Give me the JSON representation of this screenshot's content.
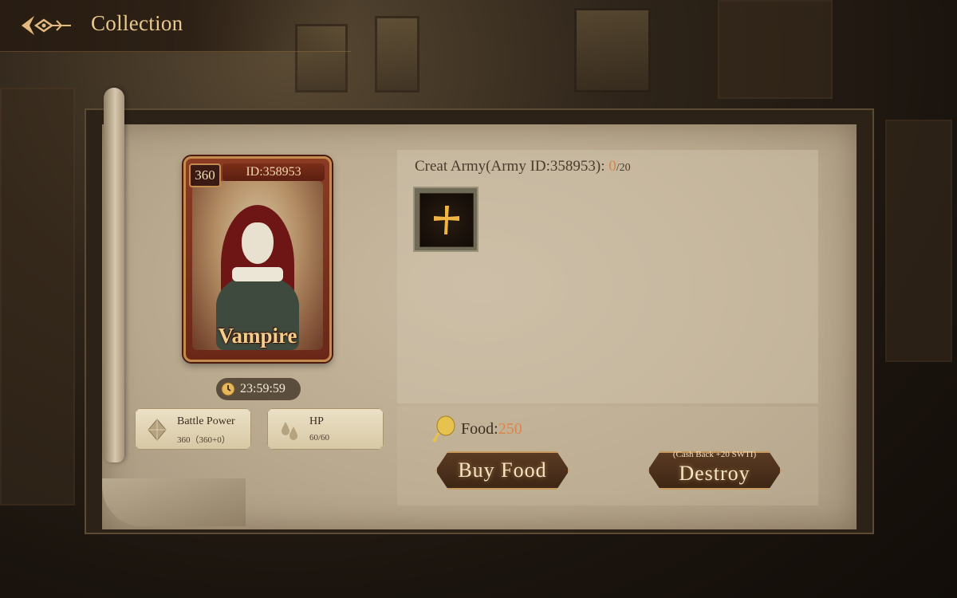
{
  "header": {
    "title": "Collection",
    "back_icon": "back-arrow-icon"
  },
  "hero": {
    "level": "360",
    "id_text": "ID:358953",
    "name": "Vampire",
    "timer": "23:59:59"
  },
  "stats": {
    "battle_power": {
      "label": "Battle Power",
      "value": "360（360+0）",
      "icon": "diamond-crystal-icon"
    },
    "hp": {
      "label": "HP",
      "value": "60/60",
      "icon": "blood-drops-icon"
    }
  },
  "army": {
    "title_prefix": "Creat Army(Army ID:358953): ",
    "current": "0",
    "max": "/20",
    "add_icon": "plus-icon"
  },
  "food": {
    "label": "Food:",
    "value": "250",
    "icon": "food-bag-icon"
  },
  "buttons": {
    "buy_food": "Buy Food",
    "destroy": "Destroy",
    "destroy_note": "(Cash Back +20 SWTI)"
  },
  "colors": {
    "accent_orange": "#d9864c",
    "title_gold": "#e9c98e",
    "parchment": "#c9baa1"
  }
}
